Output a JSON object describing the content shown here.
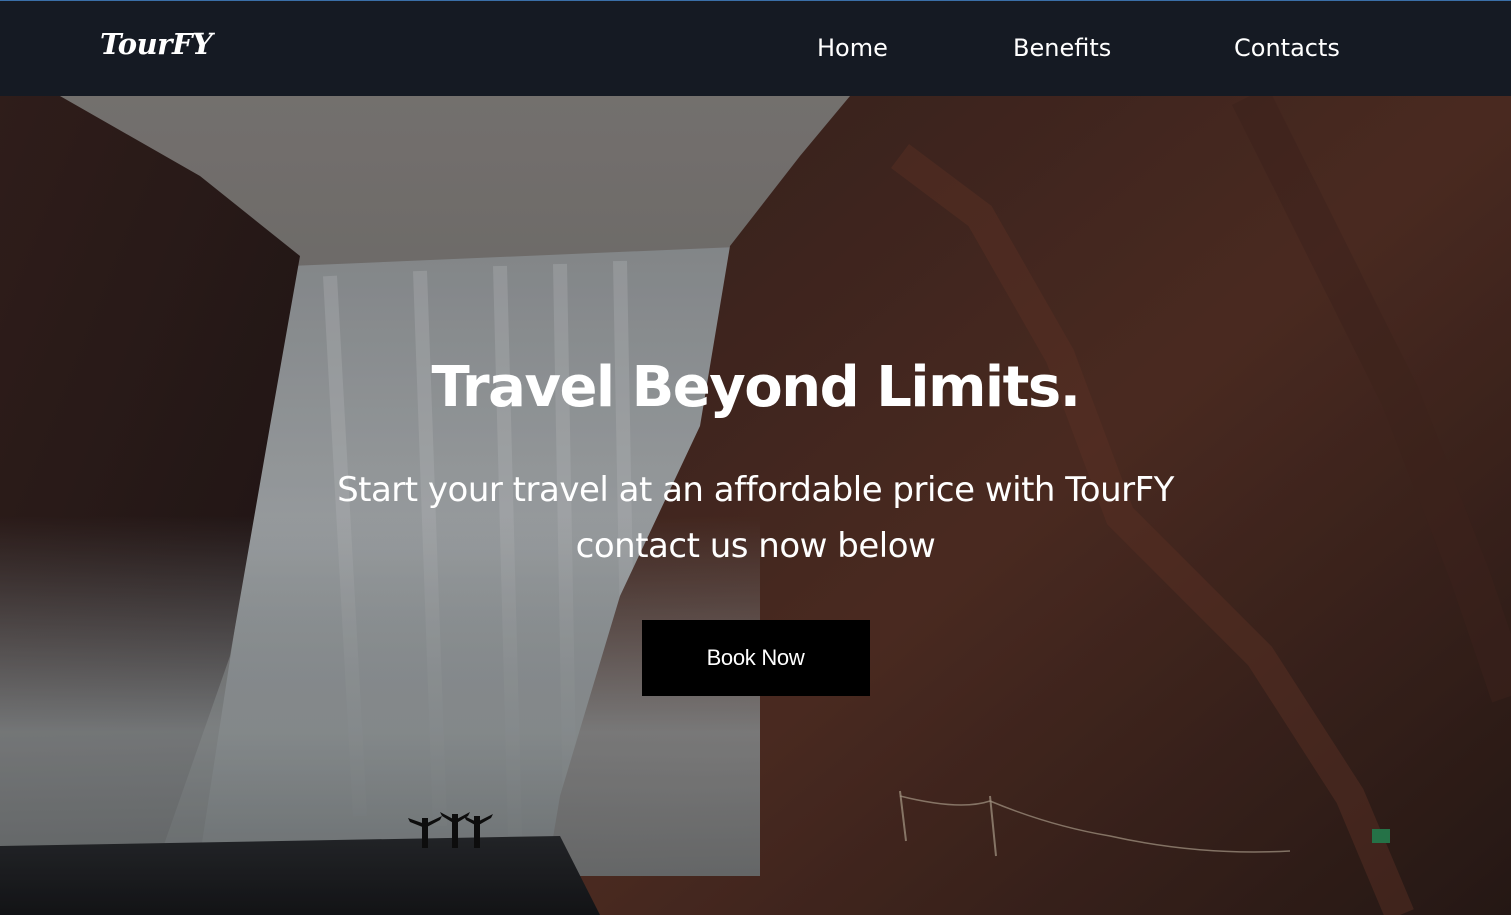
{
  "navbar": {
    "logo": "TourFY",
    "links": [
      {
        "label": "Home"
      },
      {
        "label": "Benefits"
      },
      {
        "label": "Contacts"
      }
    ]
  },
  "hero": {
    "title": "Travel Beyond Limits.",
    "subtitle": "Start your travel at an affordable price with TourFY contact us now below",
    "cta_label": "Book Now"
  },
  "colors": {
    "navbar_bg": "#151a23",
    "button_bg": "#000000",
    "text": "#ffffff"
  }
}
